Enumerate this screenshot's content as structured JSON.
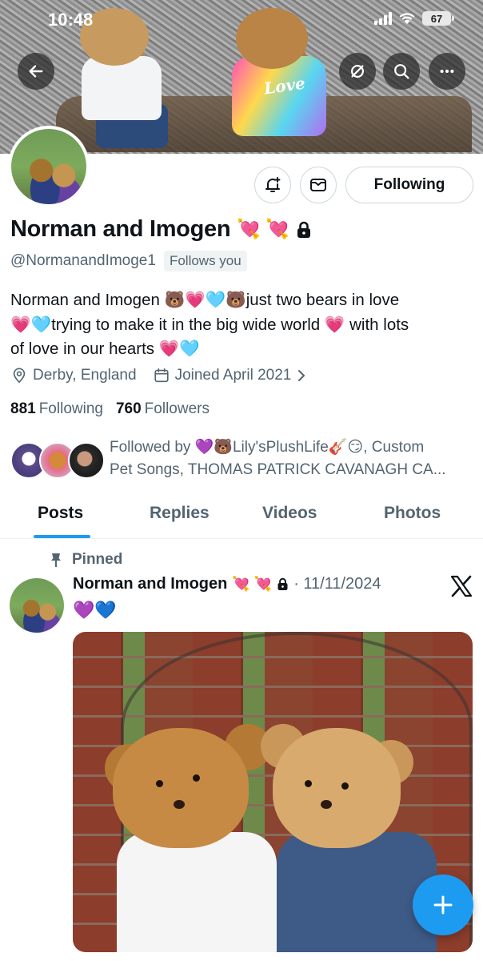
{
  "status_bar": {
    "time": "10:48",
    "battery": "67"
  },
  "banner": {
    "shirt_text": "Love"
  },
  "profile": {
    "display_name": "Norman and Imogen",
    "name_emojis": "💘 💘",
    "handle": "@NormanandImoge1",
    "follows_you": "Follows you",
    "bio_lines": [
      {
        "parts": [
          "Norman and Imogen ",
          "🐻💗🩵🐻",
          "just two bears in love"
        ]
      },
      {
        "parts": [
          "",
          "💗🩵",
          "trying to make it in the big wide world ",
          "💗",
          " with lots"
        ]
      },
      {
        "parts": [
          "of love in our hearts ",
          "💗🩵"
        ]
      }
    ],
    "location": "Derby, England",
    "joined": "Joined April 2021",
    "following_count": "881",
    "following_label": "Following",
    "followers_count": "760",
    "followers_label": "Followers",
    "followed_by_line1": "Followed by 💜🐻Lily'sPlushLife🎸😏, Custom",
    "followed_by_line2": "Pet Songs, THOMAS PATRICK CAVANAGH CA..."
  },
  "actions": {
    "following_label": "Following"
  },
  "tabs": [
    {
      "label": "Posts",
      "active": true
    },
    {
      "label": "Replies",
      "active": false
    },
    {
      "label": "Videos",
      "active": false
    },
    {
      "label": "Photos",
      "active": false
    }
  ],
  "post": {
    "pinned_label": "Pinned",
    "author": "Norman and Imogen",
    "author_emojis": "💘 💘",
    "date": "· 11/11/2024",
    "text": "💜💙"
  },
  "colors": {
    "accent": "#1d9bf0",
    "secondary_text": "#536471",
    "primary_text": "#0f1419"
  }
}
